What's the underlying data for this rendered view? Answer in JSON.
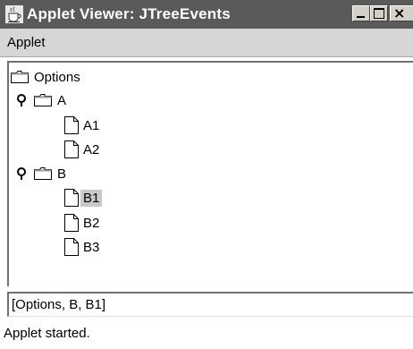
{
  "window": {
    "title": "Applet Viewer: JTreeEvents",
    "app_icon": "java-cup-icon",
    "controls": {
      "minimize": "minimize-icon",
      "maximize": "maximize-icon",
      "close_glyph": "×"
    }
  },
  "menubar": {
    "items": [
      "Applet"
    ]
  },
  "tree": {
    "root": "Options",
    "nodes": [
      {
        "label": "A",
        "type": "folder",
        "expanded": true
      },
      {
        "label": "A1",
        "type": "leaf"
      },
      {
        "label": "A2",
        "type": "leaf"
      },
      {
        "label": "B",
        "type": "folder",
        "expanded": true
      },
      {
        "label": "B1",
        "type": "leaf",
        "selected": true
      },
      {
        "label": "B2",
        "type": "leaf"
      },
      {
        "label": "B3",
        "type": "leaf"
      }
    ]
  },
  "selection_path": "[Options, B, B1]",
  "status": "Applet started.",
  "colors": {
    "titlebar": "#5a5a5a",
    "menubar": "#d6d6d6",
    "selection": "#c8c8c8"
  }
}
